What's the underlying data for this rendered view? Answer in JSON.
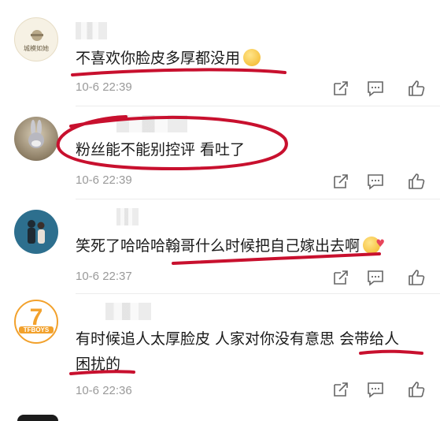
{
  "comments": [
    {
      "avatar_text": "城模如她",
      "text": "不喜欢你脸皮多厚都没用",
      "time": "10-6 22:39",
      "emoji": "smirk-emoji"
    },
    {
      "text": "粉丝能不能别控评 看吐了",
      "time": "10-6 22:39"
    },
    {
      "text": "笑死了哈哈哈翰哥什么时候把自己嫁出去啊",
      "time": "10-6 22:37",
      "emoji": "heart-eyes-emoji"
    },
    {
      "avatar_text": "TFBOYS",
      "avatar_number": "7",
      "text_line1": "有时候追人太厚脸皮 人家对你没有意思 会带给人",
      "text_line2": "困扰的",
      "time": "10-6 22:36"
    }
  ],
  "colors": {
    "annotation": "#c8102e",
    "meta": "#9a9a9a",
    "avatar_orange": "#f2a12c"
  },
  "icons": [
    "share-icon",
    "comment-icon",
    "like-icon"
  ]
}
